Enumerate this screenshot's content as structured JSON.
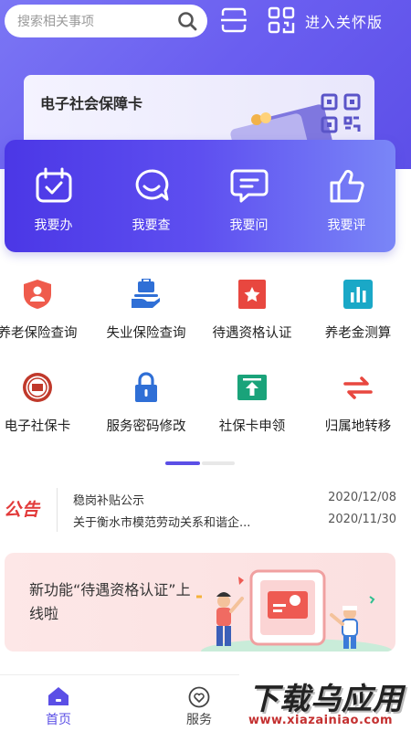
{
  "search": {
    "placeholder": "搜索相关事项"
  },
  "header": {
    "care_mode": "进入关怀版"
  },
  "card": {
    "title": "电子社会保障卡"
  },
  "actions": [
    {
      "label": "我要办",
      "icon": "calendar-check-icon"
    },
    {
      "label": "我要查",
      "icon": "search-chat-icon"
    },
    {
      "label": "我要问",
      "icon": "chat-bubble-icon"
    },
    {
      "label": "我要评",
      "icon": "thumbs-up-icon"
    }
  ],
  "services": [
    {
      "label": "养老保险查询",
      "icon": "shield-person-icon",
      "color": "#ef5b4c"
    },
    {
      "label": "失业保险查询",
      "icon": "hand-briefcase-icon",
      "color": "#2f6fd6"
    },
    {
      "label": "待遇资格认证",
      "icon": "star-card-icon",
      "color": "#e8473f"
    },
    {
      "label": "养老金测算",
      "icon": "bar-chart-icon",
      "color": "#1aa8c7"
    },
    {
      "label": "电子社保卡",
      "icon": "seal-badge-icon",
      "color": "#c0392b"
    },
    {
      "label": "服务密码修改",
      "icon": "padlock-icon",
      "color": "#2f6fd6"
    },
    {
      "label": "社保卡申领",
      "icon": "upload-card-icon",
      "color": "#1aa37a"
    },
    {
      "label": "归属地转移",
      "icon": "swap-arrows-icon",
      "color": "#e8473f"
    }
  ],
  "notice": {
    "logo": "公告",
    "items": [
      {
        "title": "稳岗补贴公示",
        "date": "2020/12/08"
      },
      {
        "title": "关于衡水市模范劳动关系和谐企...",
        "date": "2020/11/30"
      }
    ]
  },
  "banner": {
    "text": "新功能“待遇资格认证”上线啦"
  },
  "tabs": [
    {
      "label": "首页",
      "active": true,
      "color": "#5b4fe6"
    },
    {
      "label": "服务",
      "active": false,
      "color": "#444444"
    }
  ],
  "watermark": {
    "big": "下载乌应用",
    "small": "www.xiazainiao.com"
  },
  "colors": {
    "primary": "#5b4fe6",
    "notice_red": "#e23b3b",
    "banner_bg": "#fde7e7"
  }
}
